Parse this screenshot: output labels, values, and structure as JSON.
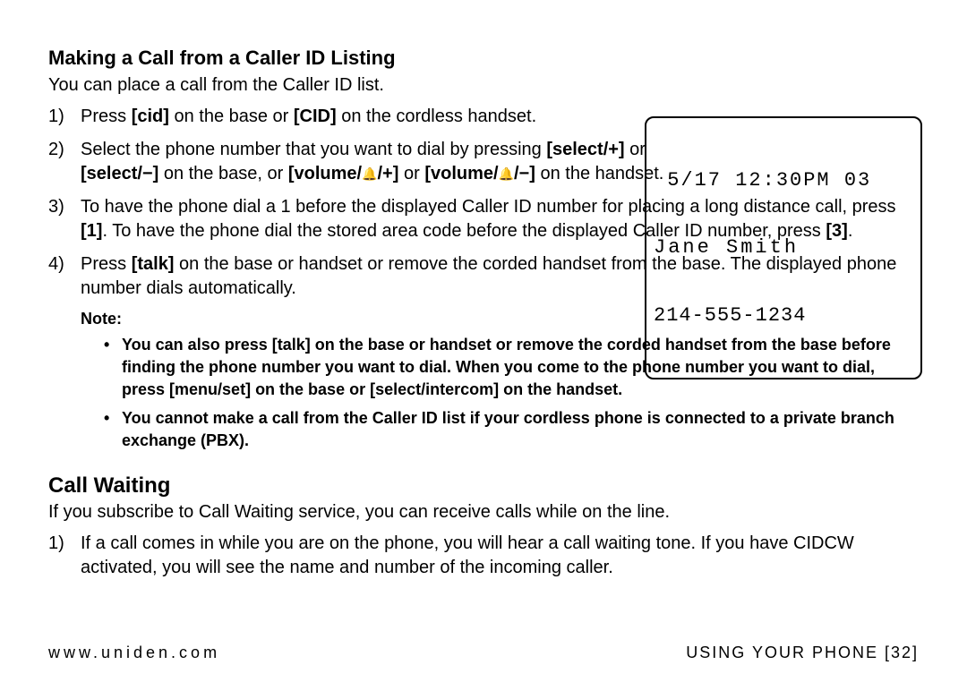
{
  "section1": {
    "heading": "Making a Call from a Caller ID Listing",
    "intro": "You can place a call from the Caller ID list.",
    "steps": {
      "s1": {
        "pre": "Press ",
        "b1": "[cid]",
        "mid": " on the base or ",
        "b2": "[CID]",
        "post": " on the cordless handset."
      },
      "s2": {
        "pre": "Select the phone number that you want to dial by pressing ",
        "b1": "[select/+]",
        "mid1": " or ",
        "b2": "[select/−]",
        "mid2": " on the base, or ",
        "b3a": "[volume/",
        "b3b": "/+]",
        "mid3": " or ",
        "b4a": "[volume/",
        "b4b": "/−]",
        "post": " on the handset."
      },
      "s3": {
        "pre": "To have the phone dial a 1 before the displayed Caller ID number for placing a long distance call, press ",
        "b1": "[1]",
        "mid": ". To have the phone dial the stored area code before the displayed Caller ID number, press ",
        "b2": "[3]",
        "post": "."
      },
      "s4": {
        "pre": "Press ",
        "b1": "[talk]",
        "post": " on the base or handset or remove the corded handset from the base. The displayed phone number dials automatically."
      }
    },
    "note_label": "Note:",
    "notes": {
      "n1": {
        "pre": "You can also press ",
        "b1": "[talk]",
        "mid1": " on the base or handset or remove the corded handset from the base before finding the phone number you want to dial. When you come to the phone number you want to dial, press ",
        "b2": "[menu/set]",
        "mid2": " on the base or ",
        "b3": "[select/intercom]",
        "post": " on the handset."
      },
      "n2": {
        "text": "You cannot make a call from the Caller ID list if your cordless phone is connected to a private branch exchange (PBX)."
      }
    }
  },
  "lcd": {
    "line1": " 5/17 12:30PM 03",
    "line2": "Jane Smith",
    "line3": "214-555-1234"
  },
  "section2": {
    "heading": "Call Waiting",
    "intro": "If you subscribe to Call Waiting service, you can receive calls while on the line.",
    "steps": {
      "s1": "If a call comes in while you are on the phone, you will hear a call waiting tone. If you have CIDCW activated, you will see the name and number of the incoming caller."
    }
  },
  "footer": {
    "url": "www.uniden.com",
    "section": "USING YOUR PHONE [32]"
  },
  "icons": {
    "bell": "🔔"
  }
}
